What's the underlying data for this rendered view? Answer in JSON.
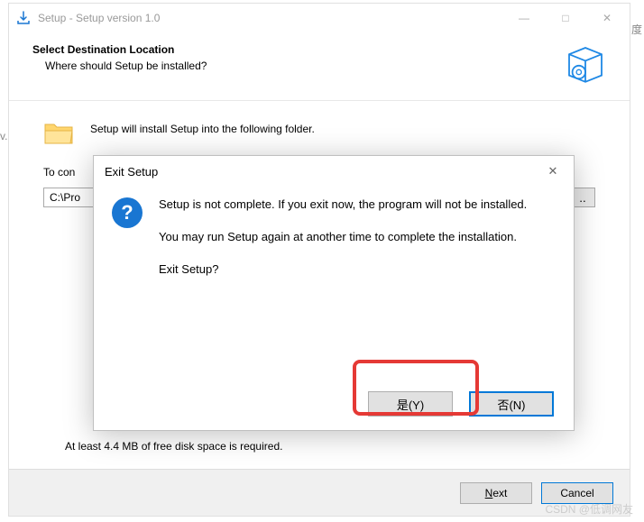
{
  "window": {
    "title": "Setup - Setup version 1.0",
    "minimize": "—",
    "maximize": "□",
    "close": "✕"
  },
  "header": {
    "title": "Select Destination Location",
    "subtitle": "Where should Setup be installed?"
  },
  "body": {
    "intro": "Setup will install Setup into the following folder.",
    "continue_fragment": "To con",
    "path_value": "C:\\Pro",
    "browse_label": "..",
    "space": "At least 4.4 MB of free disk space is required."
  },
  "footer": {
    "next": "Next",
    "cancel": "Cancel"
  },
  "modal": {
    "title": "Exit Setup",
    "close": "✕",
    "line1": "Setup is not complete. If you exit now, the program will not be installed.",
    "line2": "You may run Setup again at another time to complete the installation.",
    "line3": "Exit Setup?",
    "yes": "是(Y)",
    "no": "否(N)",
    "qmark": "?"
  },
  "misc": {
    "watermark": "CSDN @低调网友",
    "right_char": "度",
    "left_char": "v."
  }
}
